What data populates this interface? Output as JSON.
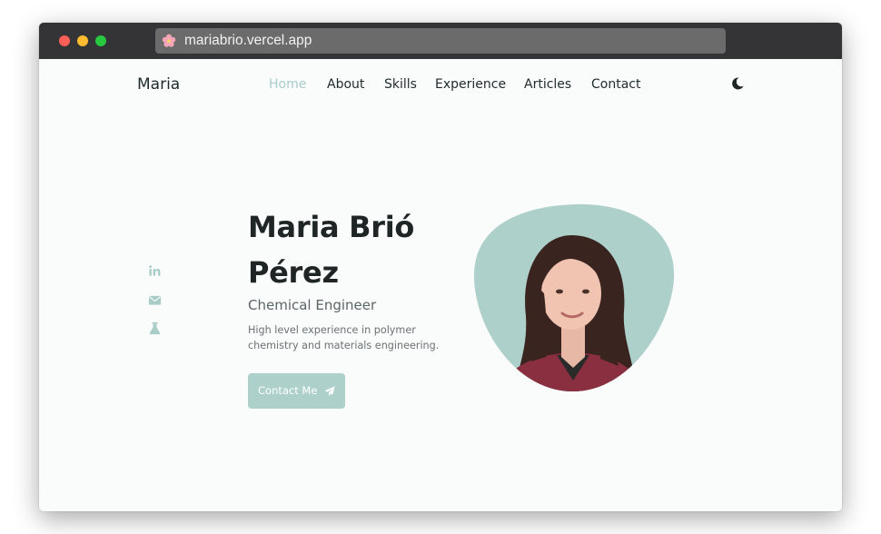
{
  "browser": {
    "url": "mariabrio.vercel.app",
    "favicon": "flower-icon"
  },
  "nav": {
    "logo": "Maria",
    "items": [
      {
        "label": "Home",
        "active": true
      },
      {
        "label": "About",
        "active": false
      },
      {
        "label": "Skills",
        "active": false
      },
      {
        "label": "Experience",
        "active": false
      },
      {
        "label": "Articles",
        "active": false
      },
      {
        "label": "Contact",
        "active": false
      }
    ],
    "theme_toggle": "moon-icon"
  },
  "social": [
    {
      "icon": "linkedin-icon"
    },
    {
      "icon": "envelope-icon"
    },
    {
      "icon": "flask-icon"
    }
  ],
  "hero": {
    "name_line1": "Maria Brió",
    "name_line2": "Pérez",
    "subtitle": "Chemical Engineer",
    "description": "High level experience in polymer chemistry and materials engineering.",
    "cta_label": "Contact Me",
    "cta_icon": "paper-plane-icon"
  },
  "colors": {
    "accent": "#aed0cb",
    "text": "#1f2424",
    "background": "#fafbfb"
  }
}
